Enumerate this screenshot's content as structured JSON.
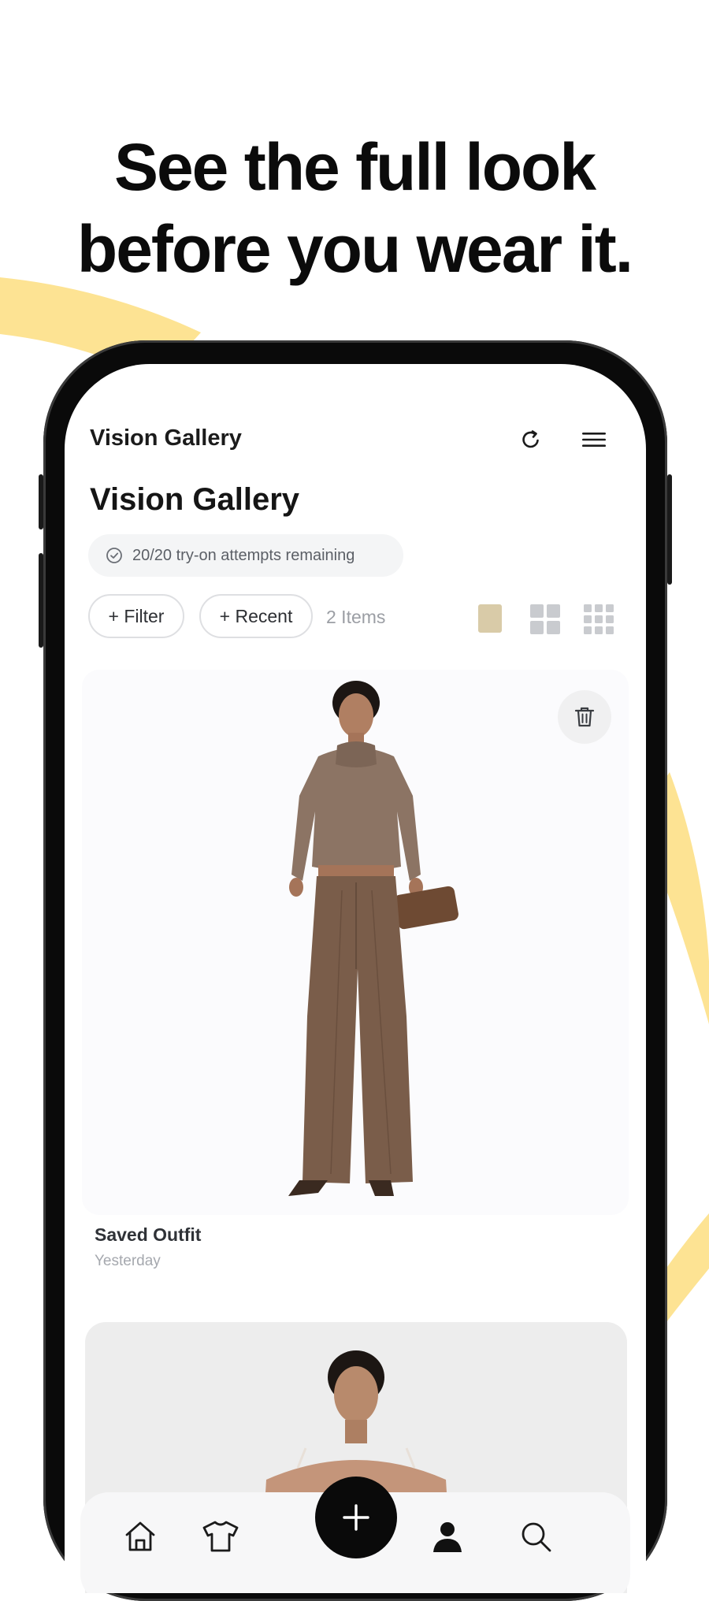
{
  "headline": {
    "line1": "See the full look",
    "line2": "before you wear it."
  },
  "colors": {
    "accent_yellow": "#FDE393",
    "swatch_beige": "#D9CBA8",
    "text_dark": "#151515"
  },
  "app_bar": {
    "title": "Vision Gallery",
    "refresh_icon": "refresh-icon",
    "menu_icon": "hamburger-menu-icon"
  },
  "page": {
    "title": "Vision Gallery",
    "attempts_text": "20/20 try-on attempts remaining",
    "attempts_icon": "check-circle-icon"
  },
  "controls": {
    "filter_label": "+ Filter",
    "recent_label": "+ Recent",
    "item_count": "2 Items",
    "view_options": [
      "single-view-icon",
      "grid-2x2-icon",
      "grid-3x3-icon"
    ]
  },
  "gallery": {
    "items": [
      {
        "title": "Saved Outfit",
        "date": "Yesterday"
      },
      {
        "title": "",
        "date": ""
      }
    ]
  },
  "bottom_nav": {
    "items": [
      "home-icon",
      "tshirt-icon",
      "plus-icon",
      "profile-icon",
      "search-icon"
    ]
  }
}
